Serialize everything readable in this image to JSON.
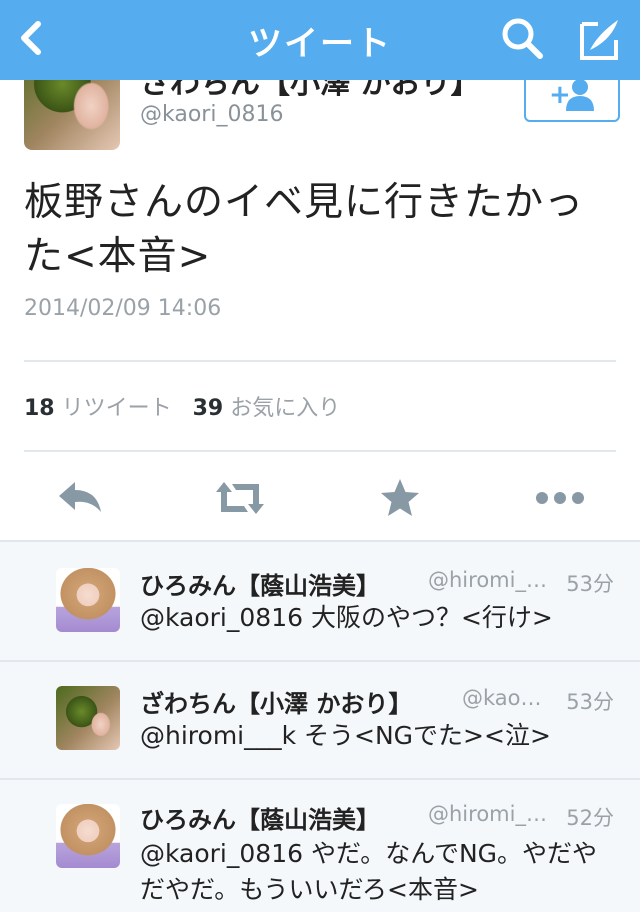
{
  "header": {
    "title": "ツイート",
    "back_icon": "chevron-left-icon",
    "search_icon": "search-icon",
    "compose_icon": "compose-icon"
  },
  "tweet": {
    "author_name": "ざわちん【小澤 かおり】",
    "author_handle": "@kaori_0816",
    "text": "板野さんのイベ見に行きたかった<本音>",
    "timestamp": "2014/02/09 14:06",
    "retweet_count": "18",
    "retweet_label": "リツイート",
    "favorite_count": "39",
    "favorite_label": "お気に入り"
  },
  "replies": [
    {
      "name": "ひろみん【蔭山浩美】",
      "handle": "@hiromi_…",
      "time": "53分",
      "text": "@kaori_0816 大阪のやつ？<行け>"
    },
    {
      "name": "ざわちん【小澤 かおり】",
      "handle": "@kao…",
      "time": "53分",
      "text": "@hiromi___k そう<NGでた><泣>"
    },
    {
      "name": "ひろみん【蔭山浩美】",
      "handle": "@hiromi_…",
      "time": "52分",
      "text": "@kaori_0816 やだ。なんでNG。やだやだやだ。もういいだろ<本音>"
    }
  ],
  "colors": {
    "brand": "#55acee",
    "muted": "#9aa2a8",
    "divider": "#e1e8ed"
  }
}
